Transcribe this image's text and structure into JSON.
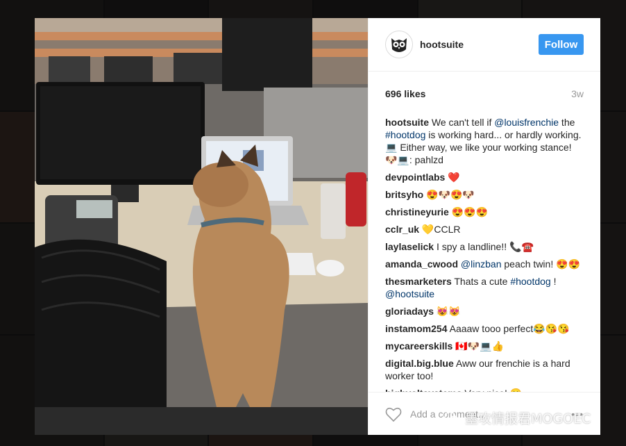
{
  "post": {
    "account": "hootsuite",
    "follow_label": "Follow",
    "likes": "696 likes",
    "age": "3w"
  },
  "comments": [
    {
      "user": "hootsuite",
      "parts": [
        {
          "t": " We can't tell if "
        },
        {
          "t": "@louisfrenchie",
          "m": true
        },
        {
          "t": " the "
        },
        {
          "t": "#hootdog",
          "m": true
        },
        {
          "t": " is working hard... or hardly working. 💻 Either way, we like your working stance! 🐶💻: pahlzd"
        }
      ]
    },
    {
      "user": "devpointlabs",
      "parts": [
        {
          "t": " ❤️"
        }
      ]
    },
    {
      "user": "britsyho",
      "parts": [
        {
          "t": " 😍🐶😍🐶"
        }
      ]
    },
    {
      "user": "christineyurie",
      "parts": [
        {
          "t": " 😍😍😍"
        }
      ]
    },
    {
      "user": "cclr_uk",
      "parts": [
        {
          "t": " 💛CCLR"
        }
      ]
    },
    {
      "user": "laylaselick",
      "parts": [
        {
          "t": " I spy a landline!! 📞☎️"
        }
      ]
    },
    {
      "user": "amanda_cwood",
      "parts": [
        {
          "t": " "
        },
        {
          "t": "@linzban",
          "m": true
        },
        {
          "t": " peach twin! 😍😍"
        }
      ]
    },
    {
      "user": "thesmarketers",
      "parts": [
        {
          "t": " Thats a cute "
        },
        {
          "t": "#hootdog",
          "m": true
        },
        {
          "t": " ! "
        },
        {
          "t": "@hootsuite",
          "m": true
        }
      ]
    },
    {
      "user": "gloriadays",
      "parts": [
        {
          "t": " 😻😻"
        }
      ]
    },
    {
      "user": "instamom254",
      "parts": [
        {
          "t": " Aaaaw tooo perfect😂😘😘"
        }
      ]
    },
    {
      "user": "mycareerskills",
      "parts": [
        {
          "t": " 🇨🇦🐶💻👍"
        }
      ]
    },
    {
      "user": "digital.big.blue",
      "parts": [
        {
          "t": " Aww our frenchie is a hard worker too!"
        }
      ]
    },
    {
      "user": "highvoltsystems",
      "parts": [
        {
          "t": " Very nice! 🙂"
        }
      ]
    }
  ],
  "add_comment": {
    "placeholder": "Add a comment...",
    "more": "•••"
  },
  "watermark": "墨攻情报君MOGOEC",
  "icons": {
    "avatar": "owl-icon",
    "like": "heart-icon",
    "watermark": "wechat-icon"
  },
  "colors": {
    "follow": "#3897f0",
    "mention": "#003569"
  }
}
